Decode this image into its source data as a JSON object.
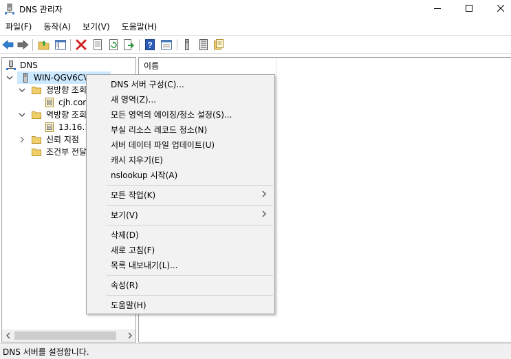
{
  "window": {
    "title": "DNS 관리자",
    "icon": "dns-server-icon"
  },
  "menubar": {
    "items": [
      {
        "label": "파일(F)"
      },
      {
        "label": "동작(A)"
      },
      {
        "label": "보기(V)"
      },
      {
        "label": "도움말(H)"
      }
    ]
  },
  "toolbar": {
    "icons": [
      "back-arrow-icon",
      "forward-arrow-icon",
      "up-folder-icon",
      "show-hide-tree-icon",
      "delete-icon",
      "properties-icon",
      "refresh-icon",
      "export-list-icon",
      "help-icon",
      "console-icon",
      "server-icon",
      "list-icon",
      "zone-icon"
    ]
  },
  "tree": {
    "root": "DNS",
    "server": "WIN-QGV6CVS",
    "forward_zone": "정방향 조회",
    "forward_child": "cjh.com",
    "reverse_zone": "역방향 조회",
    "reverse_child": "13.16.1",
    "trust_points": "신뢰 지점",
    "conditional_forwarders": "조건부 전달"
  },
  "list": {
    "column_name": "이름"
  },
  "context_menu": {
    "configure": "DNS 서버 구성(C)...",
    "new_zone": "새 영역(Z)...",
    "aging": "모든 영역의 에이징/청소 설정(S)...",
    "scavenge": "부실 리소스 레코드 청소(N)",
    "update_files": "서버 데이터 파일 업데이트(U)",
    "clear_cache": "캐시 지우기(E)",
    "nslookup": "nslookup 시작(A)",
    "all_tasks": "모든 작업(K)",
    "view": "보기(V)",
    "delete": "삭제(D)",
    "refresh": "새로 고침(F)",
    "export": "목록 내보내기(L)...",
    "properties": "속성(R)",
    "help": "도움말(H)"
  },
  "statusbar": {
    "text": "DNS 서버를 설정합니다."
  },
  "colors": {
    "selection": "#cce8ff",
    "menu_bg": "#f2f2f2",
    "status_bg": "#f0f0f0"
  }
}
